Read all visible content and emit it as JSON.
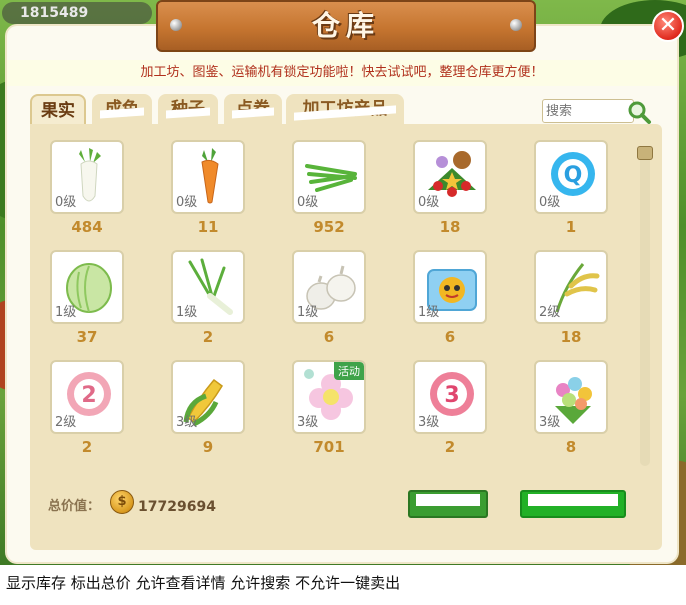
{
  "player": {
    "id_counter": "1815489"
  },
  "window": {
    "title": "仓库",
    "close_label": "✕"
  },
  "notice": "加工坊、图鉴、运输机有锁定功能啦！快去试试吧，整理仓库更方便！",
  "tabs": [
    {
      "label": "果实",
      "active": true
    },
    {
      "label": "成色",
      "active": false
    },
    {
      "label": "种子",
      "active": false
    },
    {
      "label": "点券",
      "active": false
    },
    {
      "label": "加工坊产品",
      "active": false
    }
  ],
  "search": {
    "placeholder": "搜索"
  },
  "items": [
    {
      "level": "0级",
      "count": "484",
      "icon": "radish-icon"
    },
    {
      "level": "0级",
      "count": "11",
      "icon": "carrot-icon"
    },
    {
      "level": "0级",
      "count": "952",
      "icon": "green-onion-icon"
    },
    {
      "level": "0级",
      "count": "18",
      "icon": "christmas-bouquet-icon"
    },
    {
      "level": "0级",
      "count": "1",
      "icon": "blue-q-badge-icon"
    },
    {
      "level": "1级",
      "count": "37",
      "icon": "cabbage-icon"
    },
    {
      "level": "1级",
      "count": "2",
      "icon": "scallion-icon"
    },
    {
      "level": "1级",
      "count": "6",
      "icon": "garlic-icon"
    },
    {
      "level": "1级",
      "count": "6",
      "icon": "puzzle-pumpkin-icon"
    },
    {
      "level": "2级",
      "count": "18",
      "icon": "rice-icon"
    },
    {
      "level": "2级",
      "count": "2",
      "icon": "pink-2-badge-icon"
    },
    {
      "level": "3级",
      "count": "9",
      "icon": "corn-icon"
    },
    {
      "level": "3级",
      "count": "701",
      "icon": "flower-icon",
      "tag": "活动"
    },
    {
      "level": "3级",
      "count": "2",
      "icon": "pink-3-badge-icon"
    },
    {
      "level": "3级",
      "count": "8",
      "icon": "candy-bouquet-icon"
    }
  ],
  "footer": {
    "total_label": "总价值：",
    "coin_symbol": "$",
    "total_value": "17729694"
  },
  "caption": "显示库存 标出总价 允许查看详情 允许搜索 不允许一键卖出"
}
